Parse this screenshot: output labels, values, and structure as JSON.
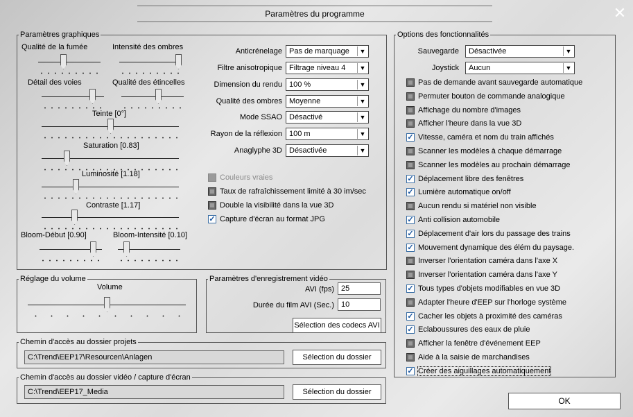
{
  "window": {
    "title": "Paramètres du programme",
    "close_glyph": "✕"
  },
  "graphics": {
    "legend": "Paramètres graphiques",
    "smoke_label": "Qualité de la fumée",
    "smoke_value": 0.4,
    "shadow_intensity_label": "Intensité des ombres",
    "shadow_intensity_value": 1.0,
    "tracks_label": "Détail des voies",
    "tracks_value": 0.85,
    "sparks_label": "Qualité des étincelles",
    "sparks_value": 0.6,
    "hue_label": "Teinte [0°]",
    "hue_value": 0.5,
    "saturation_label": "Saturation [0.83]",
    "saturation_value": 0.17,
    "luminosity_label": "Luminosité [1.18]",
    "luminosity_value": 0.24,
    "contrast_label": "Contraste [1.17]",
    "contrast_value": 0.23,
    "bloom_start_label": "Bloom-Début [0.90]",
    "bloom_start_value": 0.9,
    "bloom_intensity_label": "Bloom-Intensité [0.10]",
    "bloom_intensity_value": 0.1,
    "antialias_label": "Anticrénelage",
    "antialias_value": "Pas de marquage",
    "aniso_label": "Filtre anisotropique",
    "aniso_value": "Filtrage niveau 4",
    "render_dim_label": "Dimension du rendu",
    "render_dim_value": "100 %",
    "shadow_quality_label": "Qualité des ombres",
    "shadow_quality_value": "Moyenne",
    "ssao_label": "Mode SSAO",
    "ssao_value": "Désactivé",
    "reflection_label": "Rayon de la réflexion",
    "reflection_value": "100 m",
    "anaglyph_label": "Anaglyphe 3D",
    "anaglyph_value": "Désactivée",
    "options": [
      {
        "label": "Couleurs vraies",
        "state": "disabled"
      },
      {
        "label": "Taux de rafraîchissement limité à 30 im/sec",
        "state": "off"
      },
      {
        "label": "Double la visibilité dans la vue 3D",
        "state": "off"
      },
      {
        "label": "Capture d'écran au format JPG",
        "state": "on"
      }
    ]
  },
  "volume": {
    "legend": "Réglage du volume",
    "label": "Volume",
    "value": 0.5
  },
  "video": {
    "legend": "Paramètres d'enregistrement vidéo",
    "fps_label": "AVI (fps)",
    "fps_value": "25",
    "duration_label": "Durée du film AVI (Sec.)",
    "duration_value": "10",
    "codec_button": "Sélection des codecs AVI"
  },
  "projects": {
    "legend": "Chemin d'accès au dossier projets",
    "path": "C:\\Trend\\EEP17\\Resourcen\\Anlagen",
    "button": "Sélection du dossier"
  },
  "media": {
    "legend": "Chemin d'accès au dossier vidéo / capture d'écran",
    "path": "C:\\Trend\\EEP17_Media",
    "button": "Sélection du dossier"
  },
  "features": {
    "legend": "Options des fonctionnalités",
    "save_label": "Sauvegarde",
    "save_value": "Désactivée",
    "joystick_label": "Joystick",
    "joystick_value": "Aucun",
    "items": [
      {
        "label": "Pas de demande avant sauvegarde automatique",
        "state": "off"
      },
      {
        "label": "Permuter bouton de commande analogique",
        "state": "off"
      },
      {
        "label": "Affichage du nombre d'images",
        "state": "off"
      },
      {
        "label": "Afficher l'heure dans la vue 3D",
        "state": "off"
      },
      {
        "label": "Vitesse, caméra et nom du train affichés",
        "state": "on"
      },
      {
        "label": "Scanner les modèles à chaque démarrage",
        "state": "off"
      },
      {
        "label": "Scanner les modèles au prochain démarrage",
        "state": "off"
      },
      {
        "label": "Déplacement libre des fenêtres",
        "state": "on"
      },
      {
        "label": "Lumière automatique on/off",
        "state": "on"
      },
      {
        "label": "Aucun rendu si matériel non visible",
        "state": "off"
      },
      {
        "label": "Anti collision automobile",
        "state": "on"
      },
      {
        "label": "Déplacement d'air lors du passage des trains",
        "state": "on"
      },
      {
        "label": "Mouvement dynamique des élém du paysage.",
        "state": "on"
      },
      {
        "label": "Inverser l'orientation caméra dans l'axe X",
        "state": "off"
      },
      {
        "label": "Inverser l'orientation caméra dans l'axe Y",
        "state": "off"
      },
      {
        "label": "Tous types d'objets modifiables en vue 3D",
        "state": "on"
      },
      {
        "label": "Adapter l'heure d'EEP sur l'horloge système",
        "state": "off"
      },
      {
        "label": "Cacher les objets à proximité des caméras",
        "state": "on"
      },
      {
        "label": "Eclaboussures des eaux de pluie",
        "state": "on"
      },
      {
        "label": "Afficher la fenêtre d'événement EEP",
        "state": "off"
      },
      {
        "label": "Aide à la saisie de marchandises",
        "state": "off"
      },
      {
        "label": "Créer des aiguillages automatiquement",
        "state": "on"
      }
    ]
  },
  "ok_button": "OK",
  "icons": {
    "checkmark": "✓",
    "dropdown_arrow": "▼"
  }
}
